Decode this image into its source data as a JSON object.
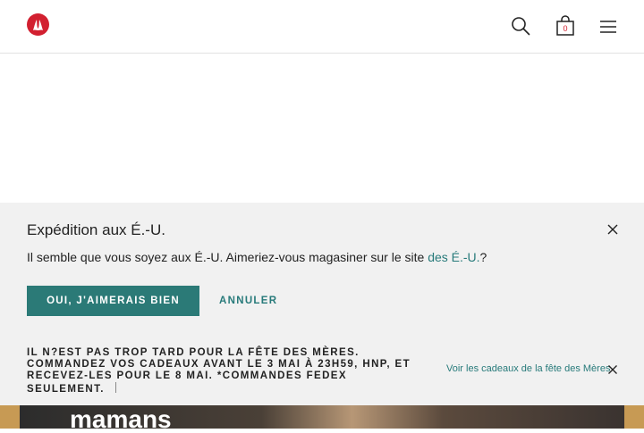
{
  "header": {
    "logo_icon": "lululemon-logo-icon",
    "search_icon": "search-icon",
    "bag_icon": "shopping-bag-icon",
    "bag_count": "0",
    "menu_icon": "hamburger-menu-icon"
  },
  "hero": {
    "headline_fragment": "mamans"
  },
  "shipping_panel": {
    "title": "Expédition aux É.-U.",
    "message_prefix": "Il semble que vous soyez aux É.-U. Aimeriez-vous magasiner sur le site ",
    "message_link": "des É.-U.",
    "message_suffix": "?",
    "confirm_label": "OUI, J'AIMERAIS BIEN",
    "cancel_label": "ANNULER",
    "close_icon": "close-icon"
  },
  "promo_banner": {
    "text": "IL N?EST PAS TROP TARD POUR LA FÊTE DES MÈRES. COMMANDEZ VOS CADEAUX AVANT LE 3 MAI À 23H59, HNP, ET RECEVEZ-LES POUR LE 8 MAI. *COMMANDES FEDEX SEULEMENT.",
    "link_label": "Voir les cadeaux de la fête des Mères",
    "close_icon": "close-icon"
  },
  "colors": {
    "accent": "#2b7a77",
    "brand_red": "#d22030",
    "panel_bg": "#f1f1f1"
  }
}
